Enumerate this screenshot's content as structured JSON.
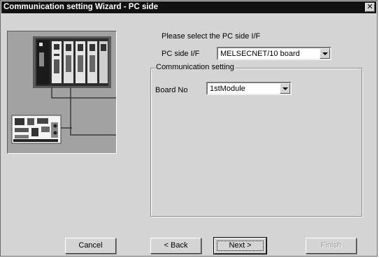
{
  "window": {
    "title": "Communication setting Wizard - PC side",
    "close_glyph": "✕"
  },
  "prompt": "Please select the PC side I/F",
  "pc_side_if": {
    "label": "PC side I/F",
    "value": "MELSECNET/10 board"
  },
  "group": {
    "title": "Communication setting",
    "board_no": {
      "label": "Board No",
      "value": "1stModule"
    }
  },
  "buttons": {
    "cancel": "Cancel",
    "back": "< Back",
    "next": "Next >",
    "finish": "Finish"
  }
}
